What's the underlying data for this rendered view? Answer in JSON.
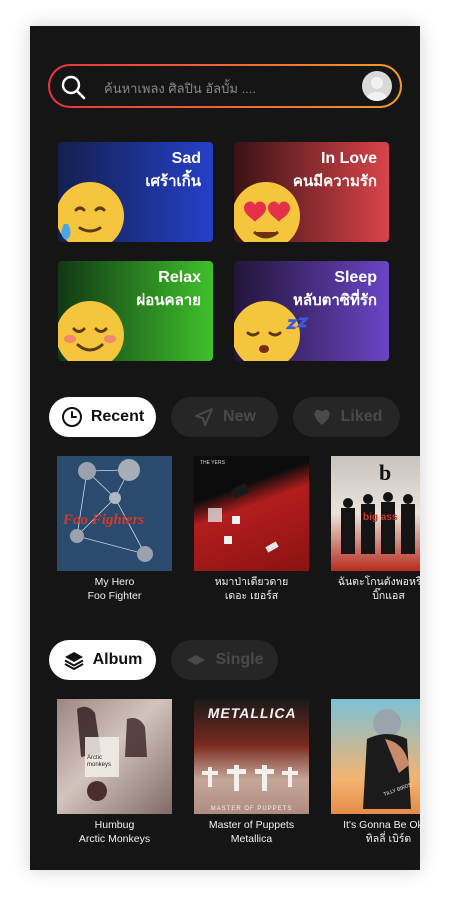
{
  "search": {
    "placeholder": "ค้นหาเพลง ศิลปิน อัลบั้ม ....",
    "value": ""
  },
  "moods": [
    {
      "en": "Sad",
      "th": "เศร้าเกิ้น",
      "from": "#13204f",
      "to": "#2540c8",
      "emoji": "sad-face-emoji"
    },
    {
      "en": "In Love",
      "th": "คนมีความรัก",
      "from": "#3a1215",
      "to": "#d94449",
      "emoji": "heart-eyes-emoji"
    },
    {
      "en": "Relax",
      "th": "ผ่อนคลาย",
      "from": "#123815",
      "to": "#3ec12a",
      "emoji": "relieved-face-emoji"
    },
    {
      "en": "Sleep",
      "th": "หลับตาซิที่รัก",
      "from": "#221538",
      "to": "#6a45c6",
      "emoji": "sleeping-face-emoji"
    }
  ],
  "tabs1": [
    {
      "label": "Recent",
      "icon": "clock-icon",
      "active": true
    },
    {
      "label": "New",
      "icon": "send-icon",
      "active": false
    },
    {
      "label": "Liked",
      "icon": "heart-icon",
      "active": false
    }
  ],
  "recent": [
    {
      "title": "My Hero",
      "artist": "Foo Fighter",
      "art_text": "Foo Fighters"
    },
    {
      "title": "หมาป่าเดียวดาย",
      "artist": "เดอะ เยอร์ส",
      "art_text": "THE YERS"
    },
    {
      "title": "ฉันตะโกนดังพอหรือยัง",
      "artist": "บิ๊กแอส",
      "art_text": "big ass"
    }
  ],
  "tabs2": [
    {
      "label": "Album",
      "icon": "layers-icon",
      "active": true
    },
    {
      "label": "Single",
      "icon": "disc-icon",
      "active": false
    }
  ],
  "albums": [
    {
      "title": "Humbug",
      "artist": "Arctic Monkeys",
      "art_text": "Arctic monkeys"
    },
    {
      "title": "Master of Puppets",
      "artist": "Metallica",
      "art_text": "METALLICA",
      "art_sub": "MASTER OF PUPPETS"
    },
    {
      "title": "It's Gonna Be Okay",
      "artist": "ทิลลี่ เบิร์ด",
      "art_text": "TILLY BIRDS"
    }
  ]
}
